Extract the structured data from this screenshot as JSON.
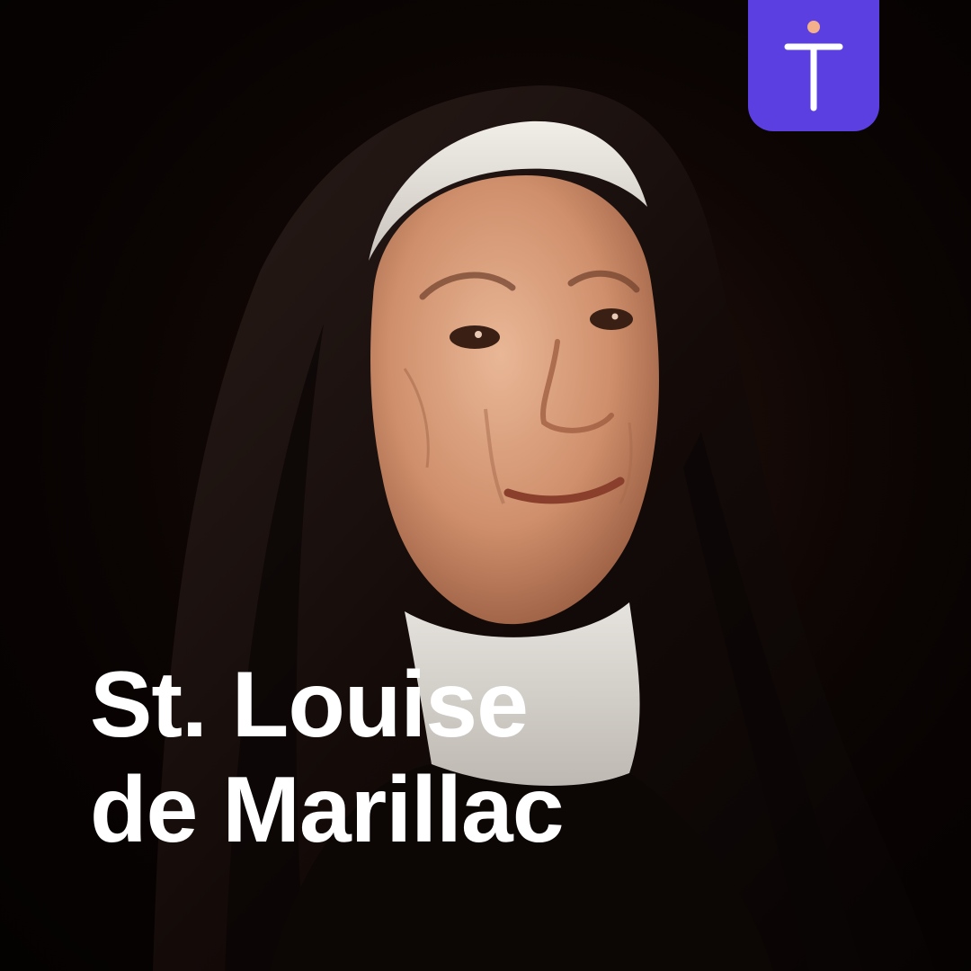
{
  "title": {
    "line1": "St. Louise",
    "line2": "de Marillac"
  },
  "portrait": {
    "subject": "nun-portrait"
  },
  "brand": {
    "icon": "t-cross-logo-icon",
    "badge_color": "#5b3fe0",
    "dot_color": "#f4b08a"
  },
  "colors": {
    "background": "#050202",
    "text": "#ffffff"
  }
}
